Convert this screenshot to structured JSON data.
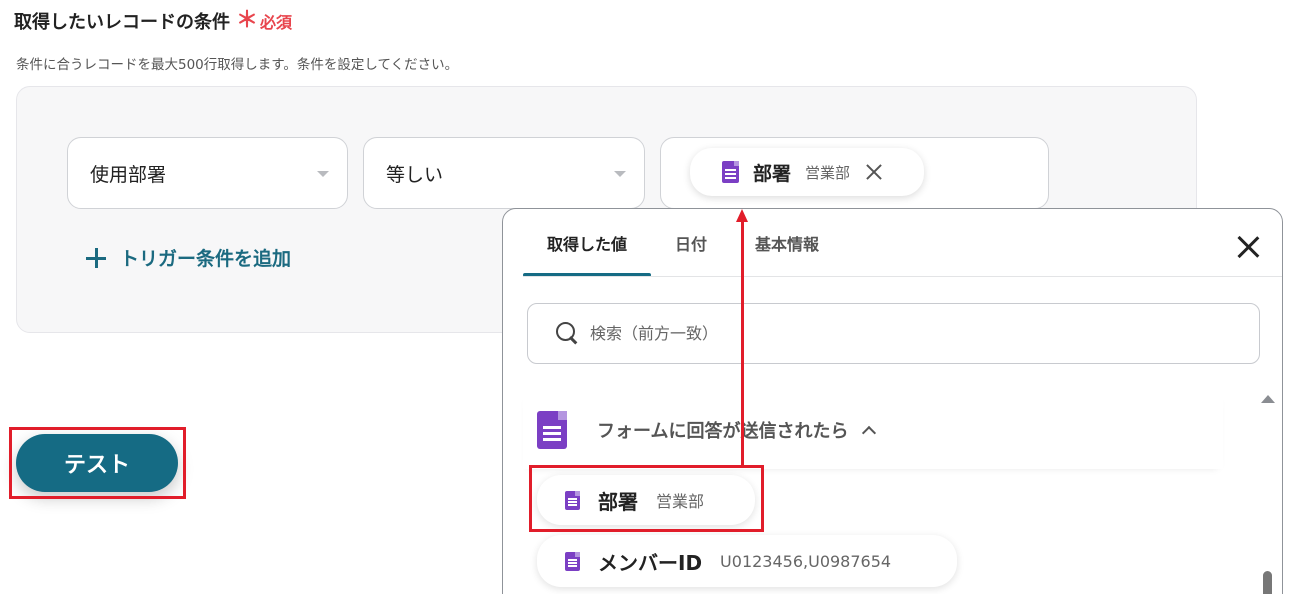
{
  "section": {
    "title": "取得したいレコードの条件",
    "required_mark": "＊",
    "required_label": "必須",
    "description": "条件に合うレコードを最大500行取得します。条件を設定してください。"
  },
  "condition": {
    "field_select": "使用部署",
    "operator_select": "等しい",
    "value_chip": {
      "name": "部署",
      "value": "営業部",
      "icon": "google-form-icon"
    }
  },
  "add_trigger_label": "トリガー条件を追加",
  "test_button": "テスト",
  "popup": {
    "tabs": [
      {
        "label": "取得した値",
        "active": true
      },
      {
        "label": "日付",
        "active": false
      },
      {
        "label": "基本情報",
        "active": false
      }
    ],
    "search_placeholder": "検索（前方一致）",
    "group": {
      "label": "フォームに回答が送信されたら",
      "expanded": true
    },
    "items": [
      {
        "name": "部署",
        "value": "営業部",
        "highlighted": true
      },
      {
        "name": "メンバーID",
        "value": "U0123456,U0987654",
        "highlighted": false
      }
    ]
  },
  "colors": {
    "accent": "#156b84",
    "required": "#e8454d",
    "highlight": "#e11d2a",
    "form_icon": "#7b3fc4"
  }
}
